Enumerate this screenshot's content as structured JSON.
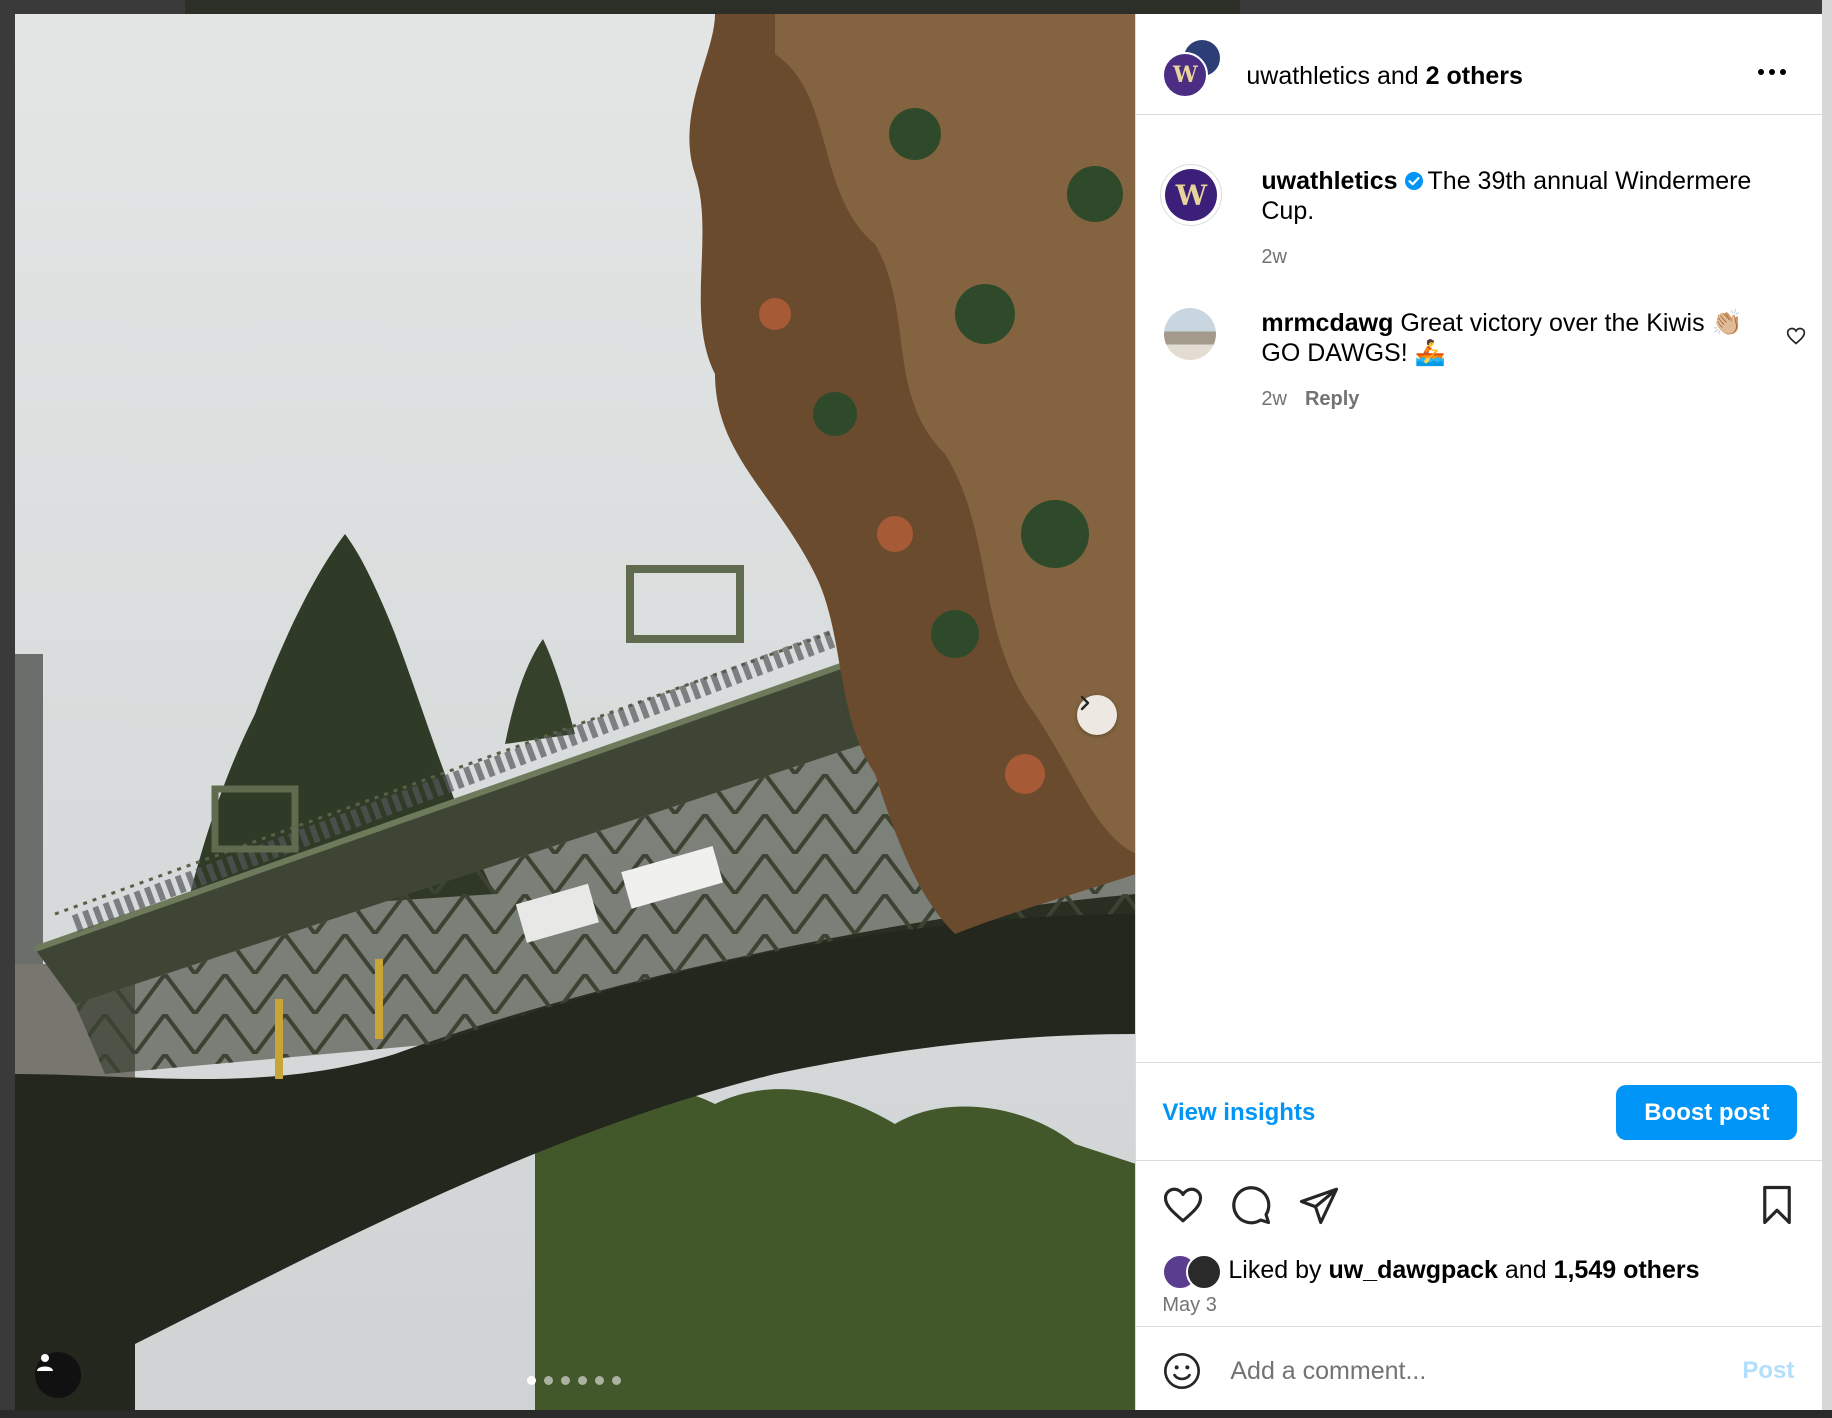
{
  "post": {
    "header": {
      "username": "uwathletics",
      "joiner": "and",
      "others": "2 others"
    },
    "caption": {
      "username": "uwathletics",
      "text": "The 39th annual Windermere Cup.",
      "time": "2w",
      "avatar_letter": "W"
    },
    "comments": [
      {
        "username": "mrmcdawg",
        "text": "Great victory over the Kiwis 👏🏼 GO DAWGS! 🚣",
        "time": "2w",
        "reply_label": "Reply"
      }
    ],
    "insights_label": "View insights",
    "boost_label": "Boost post",
    "likes": {
      "prefix": "Liked by",
      "user": "uw_dawgpack",
      "joiner": "and",
      "count": "1,549 others"
    },
    "date": "May 3",
    "comment_box": {
      "placeholder": "Add a comment...",
      "post_label": "Post"
    }
  },
  "carousel": {
    "total": 6,
    "current": 1
  },
  "icons": {
    "more": "more-horizontal-icon",
    "verified": "verified-badge-icon",
    "like": "heart-icon",
    "comment": "comment-icon",
    "share": "send-icon",
    "save": "bookmark-icon",
    "emoji": "emoji-icon",
    "next": "chevron-right-icon",
    "tag": "user-tag-icon"
  },
  "colors": {
    "accent": "#0095f6",
    "uw_purple": "#4b2e83",
    "muted": "#737373",
    "border": "#dbdbdb"
  }
}
